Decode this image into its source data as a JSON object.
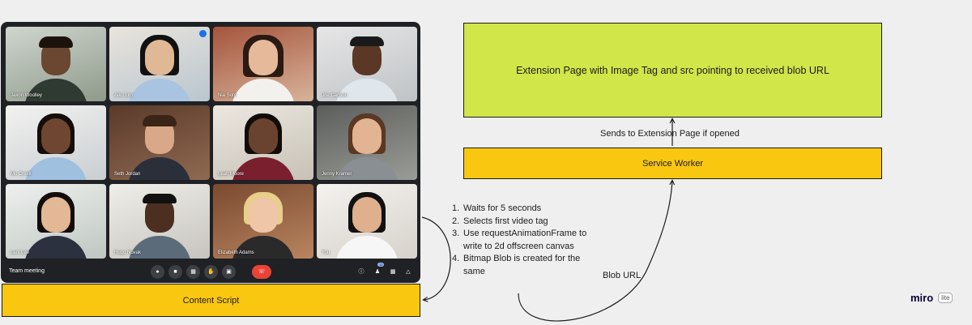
{
  "meeting": {
    "title": "Team meeting",
    "participant_badge": "12",
    "participants": [
      {
        "name": "Jaxon Woolley"
      },
      {
        "name": "Aiko Lim"
      },
      {
        "name": "Nia Soto"
      },
      {
        "name": "Joe Carlson"
      },
      {
        "name": "Mo Oneill"
      },
      {
        "name": "Seth Jordan"
      },
      {
        "name": "Leah Moore"
      },
      {
        "name": "Jenny Kramer"
      },
      {
        "name": "Lani Lee"
      },
      {
        "name": "Hugo Novak"
      },
      {
        "name": "Elizabeth Adams"
      },
      {
        "name": "You"
      }
    ],
    "controls": [
      "mic-icon",
      "camera-icon",
      "captions-icon",
      "hand-icon",
      "present-icon",
      "end-call-icon"
    ],
    "right_controls": [
      "info-icon",
      "people-icon",
      "chat-icon",
      "activities-icon"
    ]
  },
  "diagram": {
    "content_script": "Content Script",
    "service_worker": "Service Worker",
    "extension_page": "Extension Page with Image Tag and src pointing to received blob URL",
    "sends_label": "Sends to Extension Page if opened",
    "blob_label": "Blob URL",
    "steps": [
      {
        "num": "1.",
        "text": "Waits for 5 seconds"
      },
      {
        "num": "2.",
        "text": "Selects first video tag"
      },
      {
        "num": "3.",
        "text": "Use requestAnimationFrame to write to 2d offscreen canvas"
      },
      {
        "num": "4.",
        "text": "Bitmap Blob is created for the same"
      }
    ]
  },
  "branding": {
    "logo": "miro",
    "plan": "lite"
  }
}
